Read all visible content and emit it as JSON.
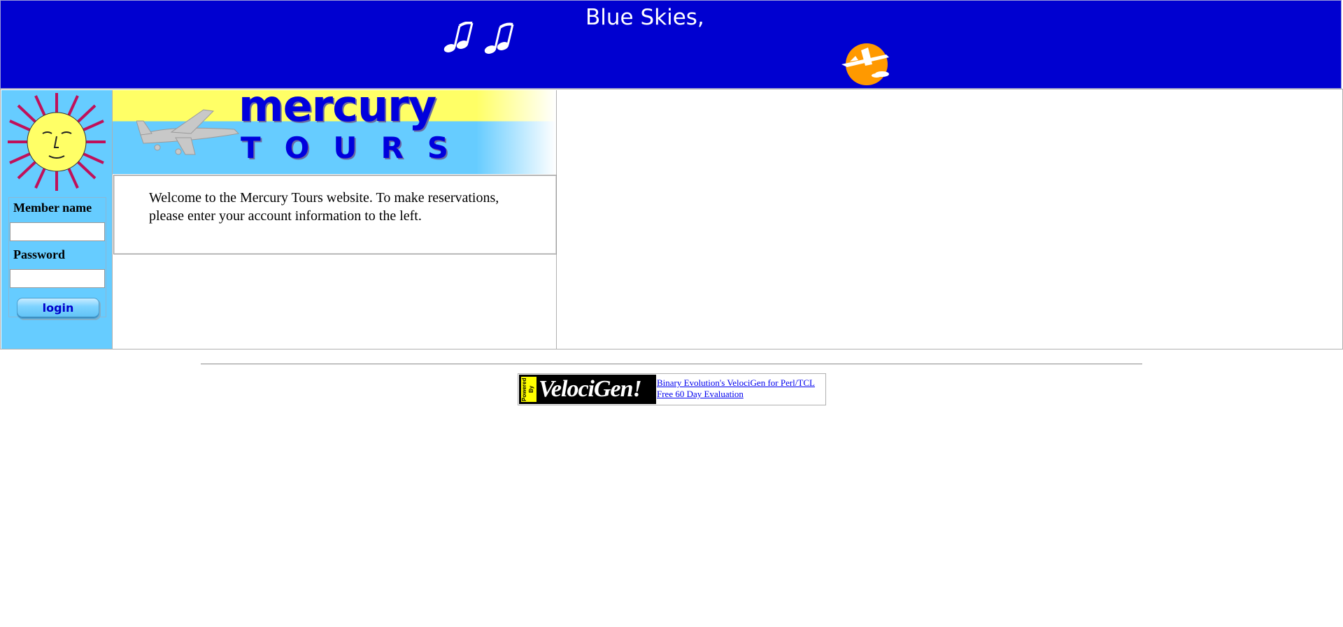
{
  "banner": {
    "title": "Blue Skies,",
    "icons": [
      "music-notes-icon",
      "sun-airplane-icon"
    ],
    "background_color": "#0000d0"
  },
  "sidebar": {
    "background_color": "#66ccff",
    "icon": "sun-face-icon",
    "login": {
      "member_label": "Member name",
      "password_label": "Password",
      "member_value": "",
      "password_value": "",
      "button_label": "login"
    }
  },
  "logo": {
    "word1": "mercury",
    "word2": "TOURS",
    "icon": "airplane-icon"
  },
  "welcome": {
    "text": "Welcome to the Mercury Tours website. To make reservations, please enter your account information to the left."
  },
  "footer": {
    "badge_powered": "Powered By",
    "badge_name": "VelociGen!",
    "link1": "Binary Evolution's VelociGen for Perl/TCL",
    "link2": "Free 60 Day Evaluation"
  }
}
